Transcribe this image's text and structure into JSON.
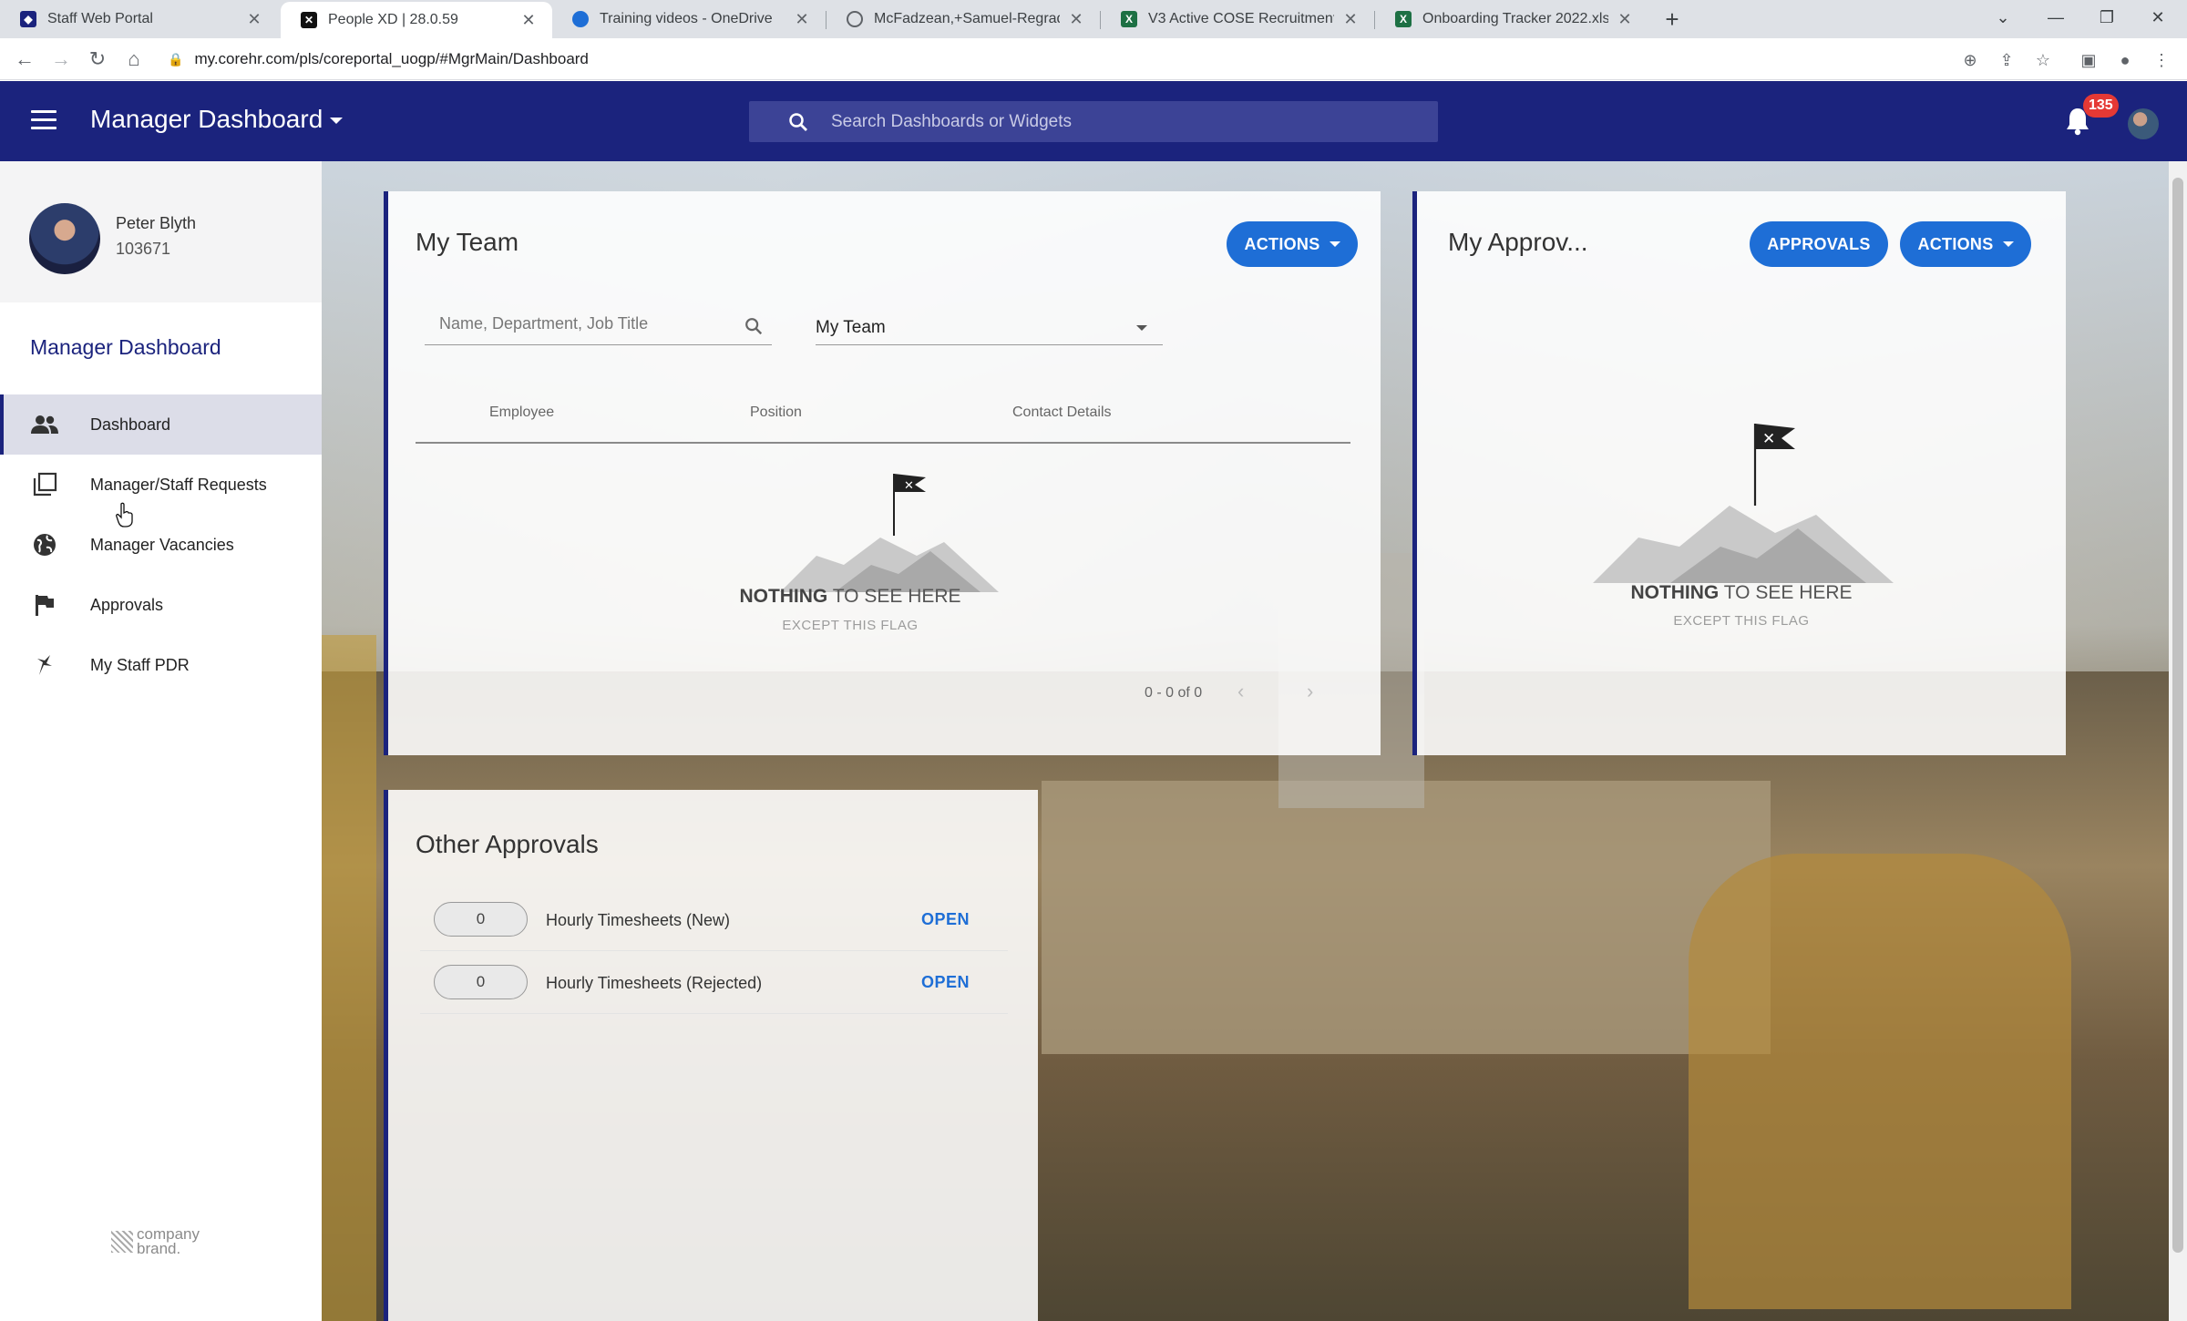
{
  "browser": {
    "tabs": [
      {
        "label": "Staff Web Portal",
        "active": false
      },
      {
        "label": "People XD | 28.0.59",
        "active": true
      },
      {
        "label": "Training videos - OneDrive",
        "active": false
      },
      {
        "label": "McFadzean,+Samuel-Regrading-",
        "active": false
      },
      {
        "label": "V3 Active COSE Recruitment Trac",
        "active": false
      },
      {
        "label": "Onboarding Tracker 2022.xlsx",
        "active": false
      }
    ],
    "url": "my.corehr.com/pls/coreportal_uogp/#MgrMain/Dashboard"
  },
  "header": {
    "title": "Manager Dashboard",
    "search_placeholder": "Search Dashboards or Widgets",
    "notification_count": "135"
  },
  "sidebar": {
    "user_name": "Peter Blyth",
    "user_id": "103671",
    "heading": "Manager Dashboard",
    "items": [
      {
        "label": "Dashboard",
        "icon": "people-icon",
        "active": true
      },
      {
        "label": "Manager/Staff Requests",
        "icon": "requests-icon",
        "active": false
      },
      {
        "label": "Manager Vacancies",
        "icon": "globe-icon",
        "active": false
      },
      {
        "label": "Approvals",
        "icon": "flag-icon",
        "active": false
      },
      {
        "label": "My Staff PDR",
        "icon": "pdr-icon",
        "active": false
      }
    ],
    "brand_line1": "company",
    "brand_line2": "brand."
  },
  "my_team": {
    "title": "My Team",
    "actions_label": "ACTIONS",
    "search_placeholder": "Name, Department, Job Title",
    "filter_value": "My Team",
    "columns": [
      "Employee",
      "Position",
      "Contact Details"
    ],
    "empty_bold": "NOTHING",
    "empty_rest": " TO SEE HERE",
    "empty_sub": "EXCEPT THIS FLAG",
    "pagination": "0 - 0 of 0"
  },
  "my_approvals": {
    "title": "My Approv...",
    "approvals_label": "APPROVALS",
    "actions_label": "ACTIONS",
    "empty_bold": "NOTHING",
    "empty_rest": " TO SEE HERE",
    "empty_sub": "EXCEPT THIS FLAG"
  },
  "other_approvals": {
    "title": "Other Approvals",
    "rows": [
      {
        "count": "0",
        "label": "Hourly Timesheets (New)",
        "action": "OPEN"
      },
      {
        "count": "0",
        "label": "Hourly Timesheets (Rejected)",
        "action": "OPEN"
      }
    ]
  },
  "colors": {
    "header_bg": "#1b237d",
    "accent_blue": "#1e6ed6",
    "badge_red": "#e53935"
  }
}
